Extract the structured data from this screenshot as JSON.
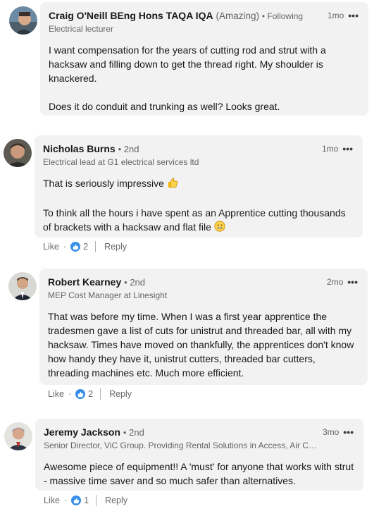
{
  "comments": [
    {
      "name": "Craig O'Neill BEng Hons TAQA IQA",
      "pronoun": "(Amazing)",
      "connection": "• Following",
      "headline": "Electrical lecturer",
      "time": "1mo",
      "paragraphs": [
        "I want compensation for the years of cutting rod and strut with a hacksaw and filling down to get the thread right. My shoulder is knackered.",
        "Does it do conduit and trunking as well? Looks great."
      ]
    },
    {
      "name": "Nicholas Burns",
      "connection": "• 2nd",
      "headline": "Electrical lead at G1 electrical services ltd",
      "time": "1mo",
      "paragraphs": [
        "That is seriously impressive",
        "To think all the hours i have spent as an Apprentice cutting thousands of brackets with a hacksaw and flat file"
      ],
      "like_label": "Like",
      "reaction_count": "2",
      "reply_label": "Reply"
    },
    {
      "name": "Robert Kearney",
      "connection": "• 2nd",
      "headline": "MEP Cost Manager at Linesight",
      "time": "2mo",
      "paragraphs": [
        "That was before my time. When I was a first year apprentice the tradesmen gave a list of cuts for unistrut and threaded bar, all with my hacksaw. Times have moved on thankfully, the apprentices don't know how handy they have it, unistrut cutters, threaded bar cutters, threading machines etc. Much more efficient."
      ],
      "like_label": "Like",
      "reaction_count": "2",
      "reply_label": "Reply"
    },
    {
      "name": "Jeremy Jackson",
      "connection": "• 2nd",
      "headline": "Senior Director, ViC Group. Providing Rental Solutions in Access, Air Co...",
      "time": "3mo",
      "paragraphs": [
        "Awesome piece of equipment!! A 'must' for anyone that works with strut - massive time saver and so much safer than alternatives."
      ],
      "like_label": "Like",
      "reaction_count": "1",
      "reply_label": "Reply"
    }
  ],
  "more_icon": "•••",
  "colors": {
    "bubble": "#f2f2f2",
    "like_blue": "#378fe9"
  }
}
